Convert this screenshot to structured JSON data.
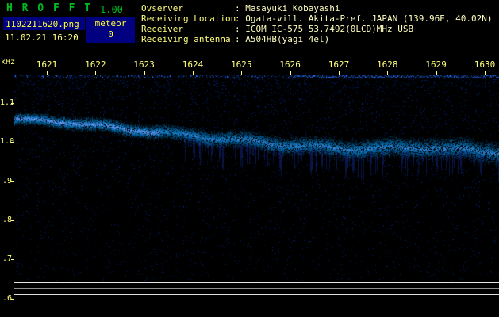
{
  "app": {
    "title": "H R O F F T",
    "version": "1.00",
    "filename": "1102211620.png",
    "meteor_label": "meteor",
    "meteor_count": "0",
    "datetime": "11.02.21 16:20"
  },
  "info": {
    "rows": [
      {
        "label": "Ovserver",
        "value": ": Masayuki Kobayashi"
      },
      {
        "label": "Receiving Location",
        "value": ": Ogata-vill. Akita-Pref. JAPAN (139.96E, 40.02N)"
      },
      {
        "label": "Receiver",
        "value": ": ICOM IC-575 53.7492(0LCD)MHz USB"
      },
      {
        "label": "Receiving antenna",
        "value": ": A504HB(yagi 4el)"
      }
    ]
  },
  "colors": {
    "background": "#000000",
    "title_green": "#00bb22",
    "label_yellow": "#ffff7d",
    "filename_yellow": "#ffff33",
    "box_navy": "#000080",
    "noise_blue": "#2244cc"
  },
  "chart_data": {
    "type": "heatmap",
    "title": "HROFFT 10-minute radio meteor observation spectrogram",
    "x": {
      "tick_labels": [
        "1621",
        "1622",
        "1623",
        "1624",
        "1625",
        "1626",
        "1627",
        "1628",
        "1629",
        "1630"
      ],
      "unit": "time hhmm (JST)"
    },
    "y": {
      "tick_labels": [
        "1.1",
        "1.0",
        ".9",
        ".8",
        ".7",
        ".6"
      ],
      "unit": "kHz",
      "top": 1.171,
      "bottom": 0.644
    },
    "carrier_band_khz_profile": [
      [
        0,
        1.055
      ],
      [
        0.12,
        1.052
      ],
      [
        0.25,
        1.033
      ],
      [
        0.4,
        1.008
      ],
      [
        0.55,
        0.995
      ],
      [
        0.7,
        0.985
      ],
      [
        0.85,
        0.982
      ],
      [
        1.0,
        0.975
      ]
    ],
    "meteor_count": 0,
    "legend": "off",
    "grid": "off",
    "background_noise": "sparse blue speckle on black, denser toward top; bright speckled edge line along top, strongest on right half; diffuse downward fuzz under band in right half",
    "signal_level_panel_lines": 4
  }
}
